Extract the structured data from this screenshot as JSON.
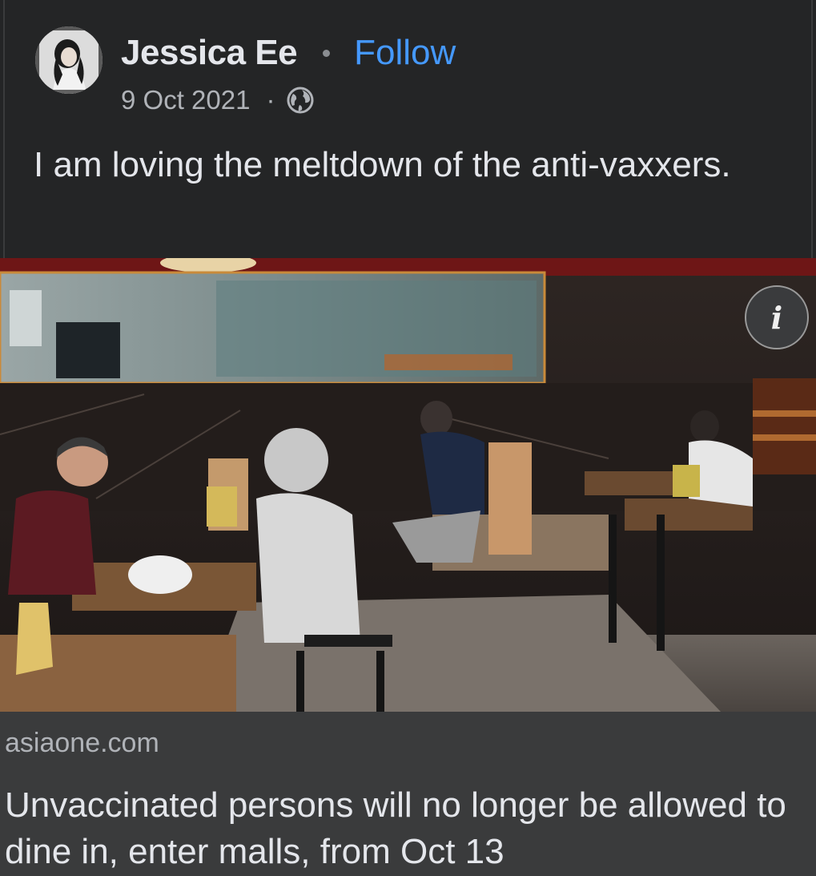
{
  "post": {
    "author": "Jessica Ee",
    "separator": "•",
    "follow_label": "Follow",
    "date": "9 Oct 2021",
    "meta_separator": "·",
    "audience_icon": "globe-icon",
    "text": "I am loving the meltdown of the anti-vaxxers."
  },
  "media": {
    "info_label": "i",
    "info_icon": "info-icon"
  },
  "link_preview": {
    "domain": "asiaone.com",
    "title": "Unvaccinated persons will no longer be allowed to dine in, enter malls, from Oct 13"
  },
  "colors": {
    "background": "#242526",
    "link_blue": "#4599ff",
    "preview_bg": "#3a3b3c",
    "secondary_text": "#b0b3b8"
  }
}
